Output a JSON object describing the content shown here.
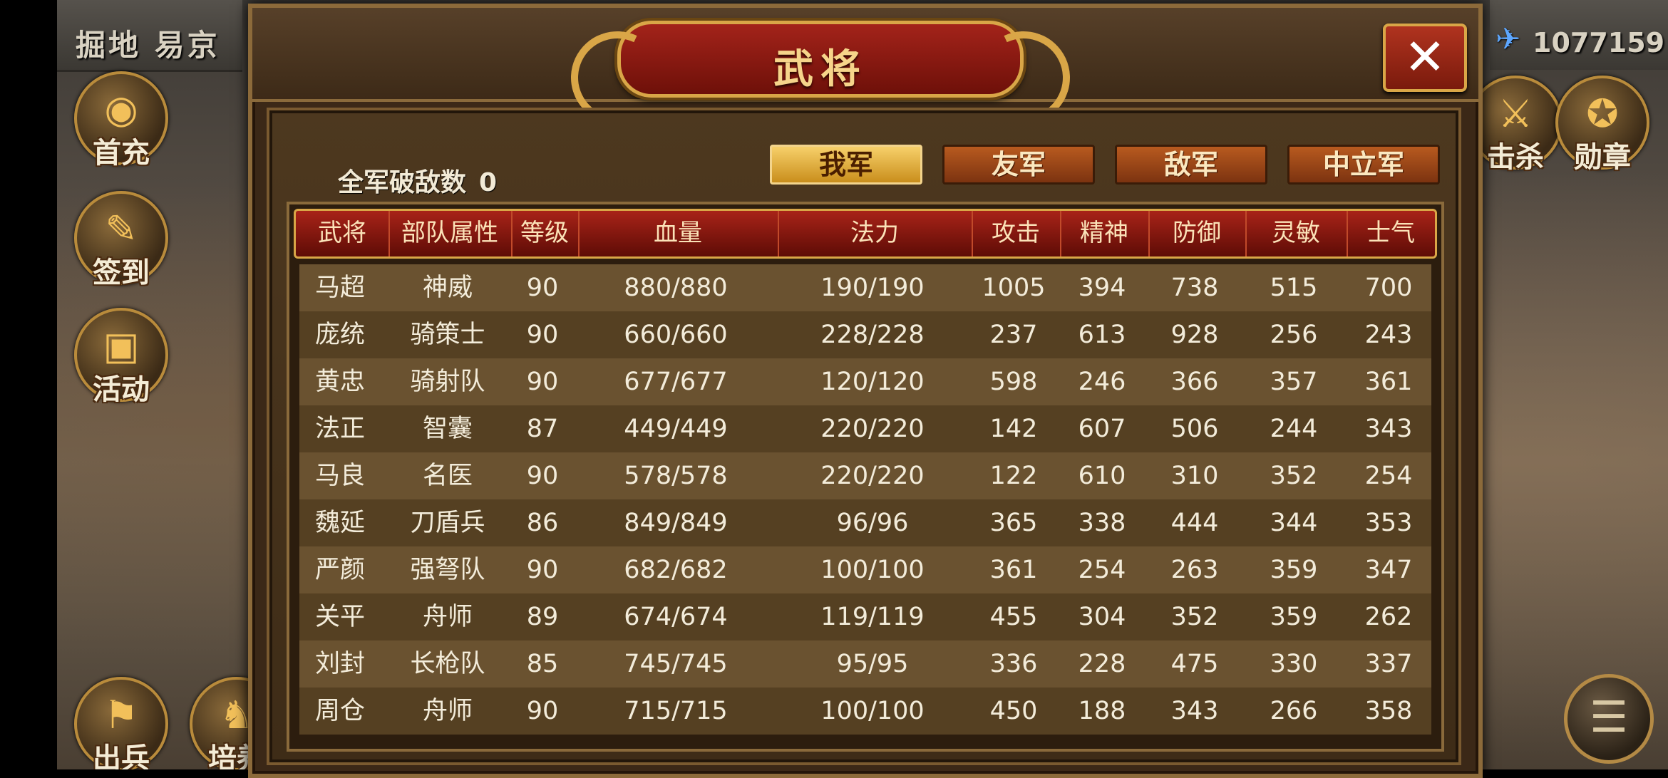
{
  "hud": {
    "location": "掘地 易京",
    "currency_icon": "wing-icon",
    "currency_value": "1077159",
    "left_buttons": [
      {
        "label": "首充",
        "icon": "money-bag-icon"
      },
      {
        "label": "签到",
        "icon": "scroll-brush-icon"
      },
      {
        "label": "活动",
        "icon": "treasure-chest-icon"
      },
      {
        "label": "出兵",
        "icon": "flag-icon"
      },
      {
        "label": "培养",
        "icon": "training-icon"
      }
    ],
    "right_buttons": [
      {
        "label": "击杀",
        "icon": "crossed-swords-icon"
      },
      {
        "label": "勋章",
        "icon": "medal-icon"
      }
    ],
    "menu_icon": "menu-icon"
  },
  "dialog": {
    "title": "武将",
    "close_label": "✕",
    "kill_count_label": "全军破敌数",
    "kill_count_value": "0",
    "tabs": [
      "我军",
      "友军",
      "敌军",
      "中立军"
    ],
    "active_tab": "我军",
    "columns": [
      "武将",
      "部队属性",
      "等级",
      "血量",
      "法力",
      "攻击",
      "精神",
      "防御",
      "灵敏",
      "士气"
    ],
    "rows": [
      [
        "马超",
        "神威",
        "90",
        "880/880",
        "190/190",
        "1005",
        "394",
        "738",
        "515",
        "700"
      ],
      [
        "庞统",
        "骑策士",
        "90",
        "660/660",
        "228/228",
        "237",
        "613",
        "928",
        "256",
        "243"
      ],
      [
        "黄忠",
        "骑射队",
        "90",
        "677/677",
        "120/120",
        "598",
        "246",
        "366",
        "357",
        "361"
      ],
      [
        "法正",
        "智囊",
        "87",
        "449/449",
        "220/220",
        "142",
        "607",
        "506",
        "244",
        "343"
      ],
      [
        "马良",
        "名医",
        "90",
        "578/578",
        "220/220",
        "122",
        "610",
        "310",
        "352",
        "254"
      ],
      [
        "魏延",
        "刀盾兵",
        "86",
        "849/849",
        "96/96",
        "365",
        "338",
        "444",
        "344",
        "353"
      ],
      [
        "严颜",
        "强弩队",
        "90",
        "682/682",
        "100/100",
        "361",
        "254",
        "263",
        "359",
        "347"
      ],
      [
        "关平",
        "舟师",
        "89",
        "674/674",
        "119/119",
        "455",
        "304",
        "352",
        "359",
        "262"
      ],
      [
        "刘封",
        "长枪队",
        "85",
        "745/745",
        "95/95",
        "336",
        "228",
        "475",
        "330",
        "337"
      ],
      [
        "周仓",
        "舟师",
        "90",
        "715/715",
        "100/100",
        "450",
        "188",
        "343",
        "266",
        "358"
      ]
    ]
  },
  "colors": {
    "header_red": "#a82318",
    "gold": "#d9a647",
    "active_tab": "#f7d06a",
    "tab": "#b85a1f"
  }
}
